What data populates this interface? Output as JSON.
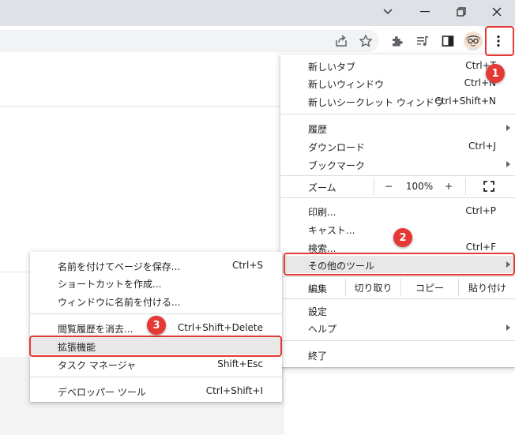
{
  "window_controls": [
    "chevron-down-icon",
    "minimize-icon",
    "restore-icon",
    "close-icon"
  ],
  "toolbar_icons": [
    "share-icon",
    "star-icon",
    "puzzle-icon",
    "reading-list-icon",
    "side-panel-icon",
    "avatar",
    "kebab-menu-icon"
  ],
  "main_menu": {
    "new_tab": {
      "label": "新しいタブ",
      "shortcut": "Ctrl+T"
    },
    "new_window": {
      "label": "新しいウィンドウ",
      "shortcut": "Ctrl+N"
    },
    "new_incognito": {
      "label": "新しいシークレット ウィンドウ",
      "shortcut": "Ctrl+Shift+N"
    },
    "history": {
      "label": "履歴"
    },
    "downloads": {
      "label": "ダウンロード",
      "shortcut": "Ctrl+J"
    },
    "bookmarks": {
      "label": "ブックマーク"
    },
    "zoom": {
      "label": "ズーム",
      "minus": "−",
      "value": "100%",
      "plus": "+"
    },
    "print": {
      "label": "印刷...",
      "shortcut": "Ctrl+P"
    },
    "cast": {
      "label": "キャスト..."
    },
    "find": {
      "label": "検索...",
      "shortcut": "Ctrl+F"
    },
    "more_tools": {
      "label": "その他のツール"
    },
    "edit": {
      "label": "編集",
      "cut": "切り取り",
      "copy": "コピー",
      "paste": "貼り付け"
    },
    "settings": {
      "label": "設定"
    },
    "help": {
      "label": "ヘルプ"
    },
    "exit": {
      "label": "終了"
    }
  },
  "sub_menu": {
    "save_as": {
      "label": "名前を付けてページを保存...",
      "shortcut": "Ctrl+S"
    },
    "create_shortcut": {
      "label": "ショートカットを作成..."
    },
    "name_window": {
      "label": "ウィンドウに名前を付ける..."
    },
    "clear_data": {
      "label": "閲覧履歴を消去...",
      "shortcut": "Ctrl+Shift+Delete"
    },
    "extensions": {
      "label": "拡張機能"
    },
    "task_manager": {
      "label": "タスク マネージャ",
      "shortcut": "Shift+Esc"
    },
    "dev_tools": {
      "label": "デベロッパー ツール",
      "shortcut": "Ctrl+Shift+I"
    }
  },
  "annotations": {
    "step1": "1",
    "step2": "2",
    "step3": "3"
  },
  "colors": {
    "annotation": "#e53935",
    "highlight": "#e8e8e8",
    "chrome_bg": "#dee1e6"
  }
}
